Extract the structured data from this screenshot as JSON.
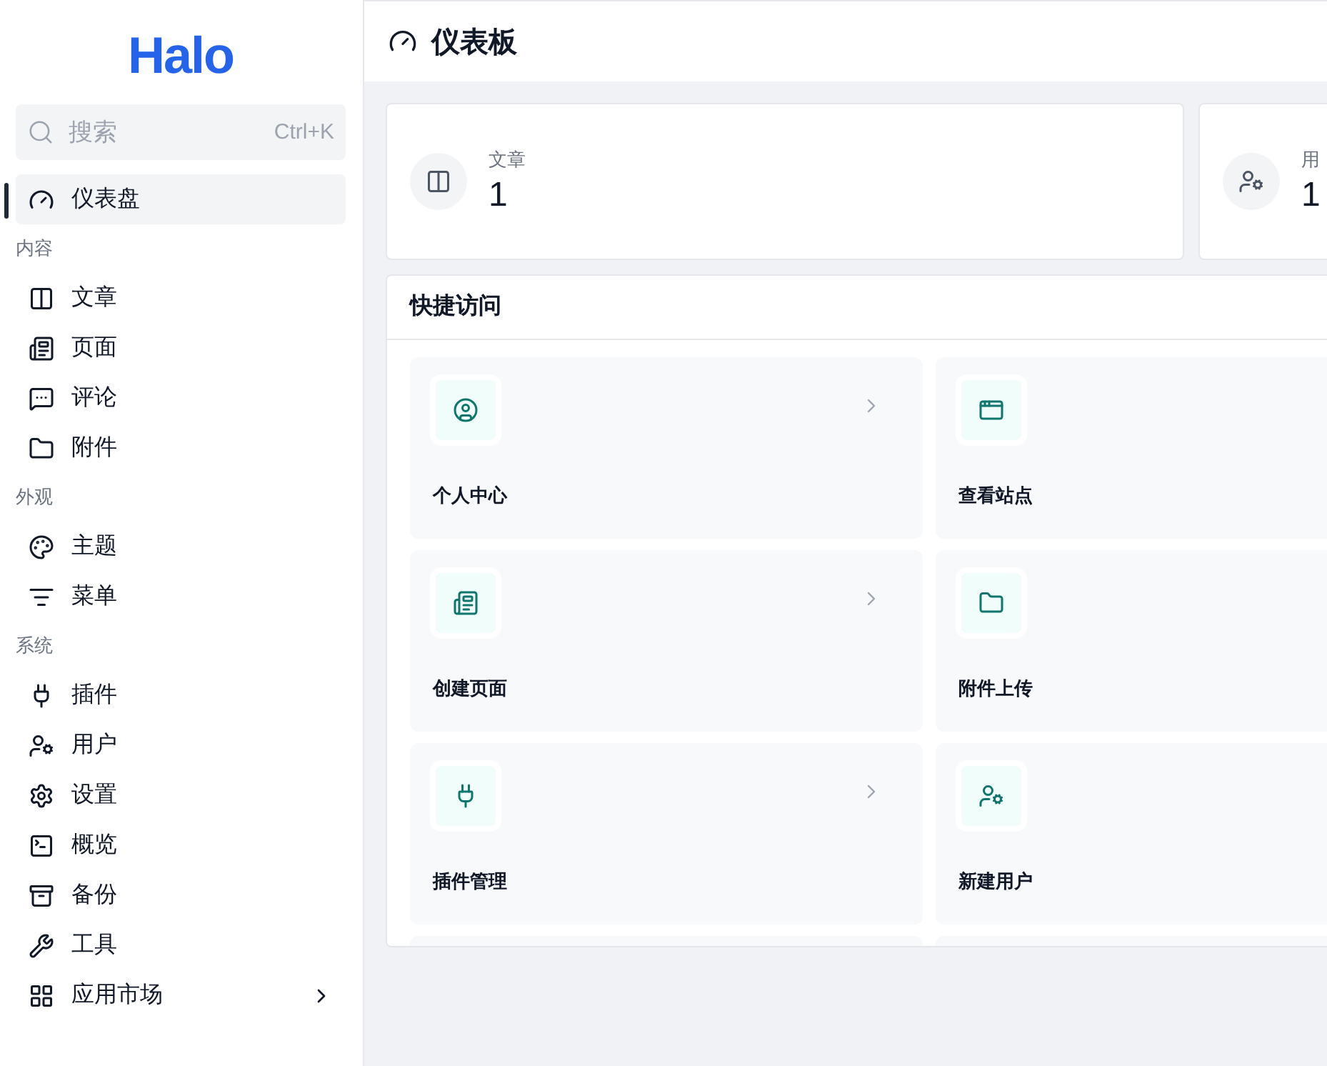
{
  "logo": "Halo",
  "search": {
    "placeholder": "搜索",
    "shortcut": "Ctrl+K"
  },
  "nav_top": [
    {
      "label": "仪表盘",
      "selected": true
    }
  ],
  "sections": [
    {
      "title": "内容",
      "items": [
        {
          "label": "文章",
          "kind": "link",
          "selected": false
        },
        {
          "label": "页面",
          "kind": "link",
          "selected": false
        },
        {
          "label": "评论",
          "kind": "link",
          "selected": false
        },
        {
          "label": "附件",
          "kind": "link",
          "selected": false
        }
      ]
    },
    {
      "title": "外观",
      "items": [
        {
          "label": "主题",
          "kind": "link",
          "selected": false
        },
        {
          "label": "菜单",
          "kind": "link",
          "selected": false
        }
      ]
    },
    {
      "title": "系统",
      "items": [
        {
          "label": "插件",
          "kind": "link",
          "selected": false
        },
        {
          "label": "用户",
          "kind": "link",
          "selected": false
        },
        {
          "label": "设置",
          "kind": "link",
          "selected": false
        },
        {
          "label": "概览",
          "kind": "link",
          "selected": false
        },
        {
          "label": "备份",
          "kind": "link",
          "selected": false
        },
        {
          "label": "工具",
          "kind": "link",
          "selected": false
        },
        {
          "label": "应用市场",
          "kind": "group",
          "selected": false
        }
      ]
    }
  ],
  "header": {
    "title": "仪表板"
  },
  "stats": [
    {
      "label": "文章",
      "value": "1"
    },
    {
      "label": "用",
      "value": "1"
    }
  ],
  "quick_access": {
    "title": "快捷访问",
    "items": [
      {
        "label": "个人中心"
      },
      {
        "label": "查看站点"
      },
      {
        "label": "创建页面"
      },
      {
        "label": "附件上传"
      },
      {
        "label": "插件管理"
      },
      {
        "label": "新建用户"
      }
    ]
  }
}
